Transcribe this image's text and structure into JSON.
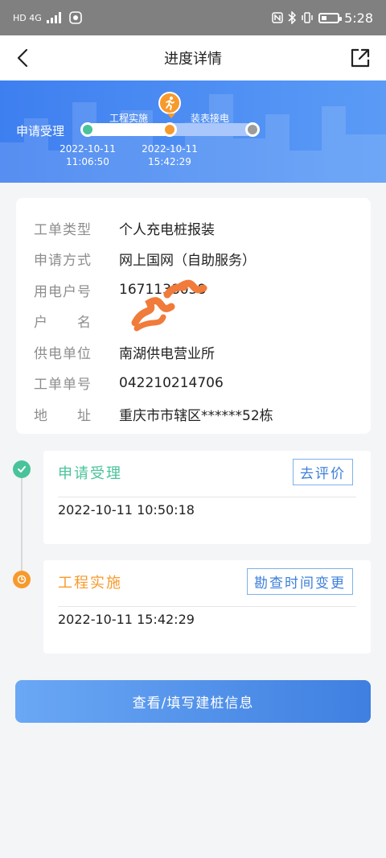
{
  "status_bar": {
    "net_labels": "HD 4G",
    "time": "5:28",
    "icons": [
      "signal-icon",
      "nfc-icon",
      "bluetooth-icon",
      "vibrate-icon",
      "battery-icon"
    ]
  },
  "header": {
    "title": "进度详情",
    "back_icon": "chevron-left-icon",
    "share_icon": "share-icon"
  },
  "progress": {
    "steps": [
      {
        "label": "申请受理",
        "date": "2022-10-11",
        "time": "11:06:50",
        "state": "done",
        "color": "#49c39a"
      },
      {
        "label": "工程实施",
        "date": "2022-10-11",
        "time": "15:42:29",
        "state": "current",
        "color": "#f79a2c"
      },
      {
        "label": "装表接电",
        "state": "pending",
        "color": "#9c9c9c"
      }
    ],
    "accent": "#3e7ff0"
  },
  "info": {
    "rows": [
      {
        "key": "工单类型",
        "value": "个人充电桩报装"
      },
      {
        "key": "申请方式",
        "value": "网上国网（自助服务）"
      },
      {
        "key": "用电户号",
        "value": "1671138038"
      },
      {
        "key_a": "户",
        "key_b": "名",
        "value": ""
      },
      {
        "key": "供电单位",
        "value": "南湖供电营业所"
      },
      {
        "key": "工单单号",
        "value": "042210214706"
      },
      {
        "key_a": "地",
        "key_b": "址",
        "value": "重庆市市辖区******52栋"
      }
    ]
  },
  "timeline": [
    {
      "title": "申请受理",
      "button": "去评价",
      "time": "2022-10-11 10:50:18",
      "icon": "check-icon",
      "color": "#49c39a"
    },
    {
      "title": "工程实施",
      "button": "勘查时间变更",
      "time": "2022-10-11 15:42:29",
      "icon": "clock-icon",
      "color": "#f79a2c"
    }
  ],
  "primary_button": "查看/填写建桩信息"
}
